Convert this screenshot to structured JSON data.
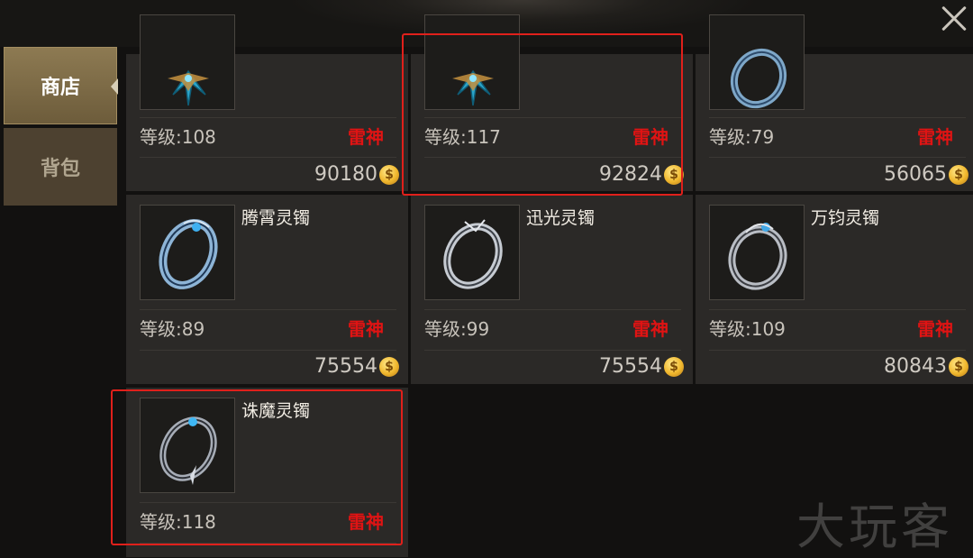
{
  "sidebar": {
    "tabs": [
      {
        "label": "商店",
        "active": true
      },
      {
        "label": "背包",
        "active": false
      }
    ]
  },
  "items": [
    {
      "name": "",
      "level": "等级:108",
      "tag": "雷神",
      "price": "90180",
      "icon": "blue-wing-artifact"
    },
    {
      "name": "",
      "level": "等级:117",
      "tag": "雷神",
      "price": "92824",
      "icon": "blue-wing-artifact"
    },
    {
      "name": "",
      "level": "等级:79",
      "tag": "雷神",
      "price": "56065",
      "icon": "blue-bracelet"
    },
    {
      "name": "腾霄灵镯",
      "level": "等级:89",
      "tag": "雷神",
      "price": "75554",
      "icon": "blue-bracelet"
    },
    {
      "name": "迅光灵镯",
      "level": "等级:99",
      "tag": "雷神",
      "price": "75554",
      "icon": "silver-bracelet"
    },
    {
      "name": "万钧灵镯",
      "level": "等级:109",
      "tag": "雷神",
      "price": "80843",
      "icon": "silver-bracelet"
    },
    {
      "name": "诛魔灵镯",
      "level": "等级:118",
      "tag": "雷神",
      "price": "",
      "icon": "thorn-bracelet"
    }
  ],
  "currency_icon": "gold-coin-icon",
  "coin_symbol": "$",
  "watermark": "大玩客",
  "colors": {
    "tag_red": "#e01313",
    "highlight": "#e0201b",
    "active_tab": "#8d7a52"
  }
}
